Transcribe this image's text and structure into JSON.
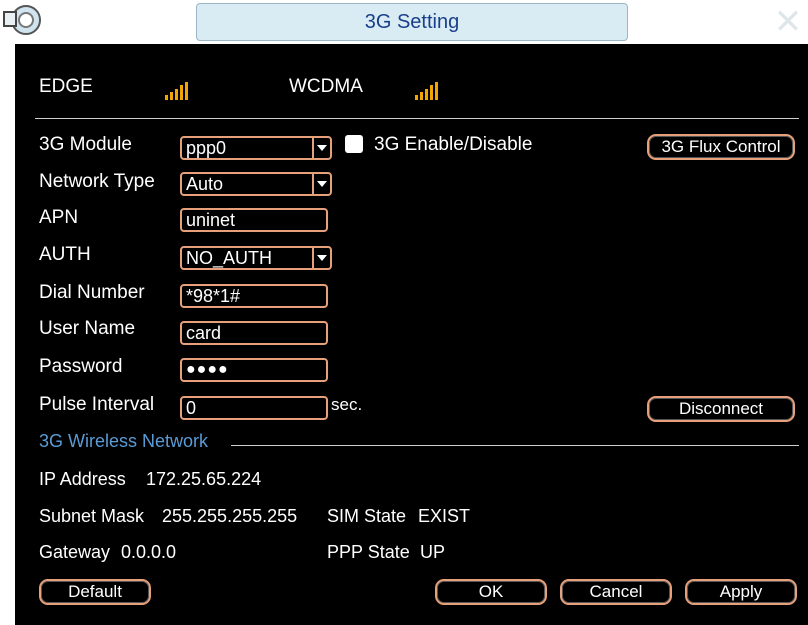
{
  "window": {
    "title": "3G Setting",
    "close_icon": "close-icon",
    "app_icon": "app-logo-icon"
  },
  "signals": [
    {
      "label": "EDGE",
      "icon": "signal-strength-icon",
      "level": 4
    },
    {
      "label": "WCDMA",
      "icon": "signal-strength-icon",
      "level": 4
    }
  ],
  "form": {
    "module_label": "3G  Module",
    "module_value": "ppp0",
    "enable_label": "3G Enable/Disable",
    "enable_checked": false,
    "flux_button": "3G Flux Control",
    "network_type_label": "Network Type",
    "network_type_value": "Auto",
    "apn_label": "APN",
    "apn_value": "uninet",
    "auth_label": "AUTH",
    "auth_value": "NO_AUTH",
    "dial_label": "Dial Number",
    "dial_value": "*98*1#",
    "user_label": "User Name",
    "user_value": "card",
    "password_label": "Password",
    "password_value": "●●●●",
    "pulse_label": "Pulse Interval",
    "pulse_value": "0",
    "pulse_unit": "sec.",
    "disconnect_button": "Disconnect"
  },
  "wireless": {
    "section_title": "3G Wireless Network",
    "ip_label": "IP Address",
    "ip_value": "172.25.65.224",
    "subnet_label": "Subnet Mask",
    "subnet_value": "255.255.255.255",
    "gateway_label": "Gateway",
    "gateway_value": "0.0.0.0",
    "sim_label": "SIM State",
    "sim_value": "EXIST",
    "ppp_label": "PPP State",
    "ppp_value": "UP"
  },
  "footer": {
    "default_button": "Default",
    "ok_button": "OK",
    "cancel_button": "Cancel",
    "apply_button": "Apply"
  },
  "colors": {
    "panel_bg": "#000000",
    "field_border": "#e6a07a",
    "signal_bar": "#f0a500",
    "section_title": "#5b9bd5",
    "title_text": "#1a3f8a"
  }
}
